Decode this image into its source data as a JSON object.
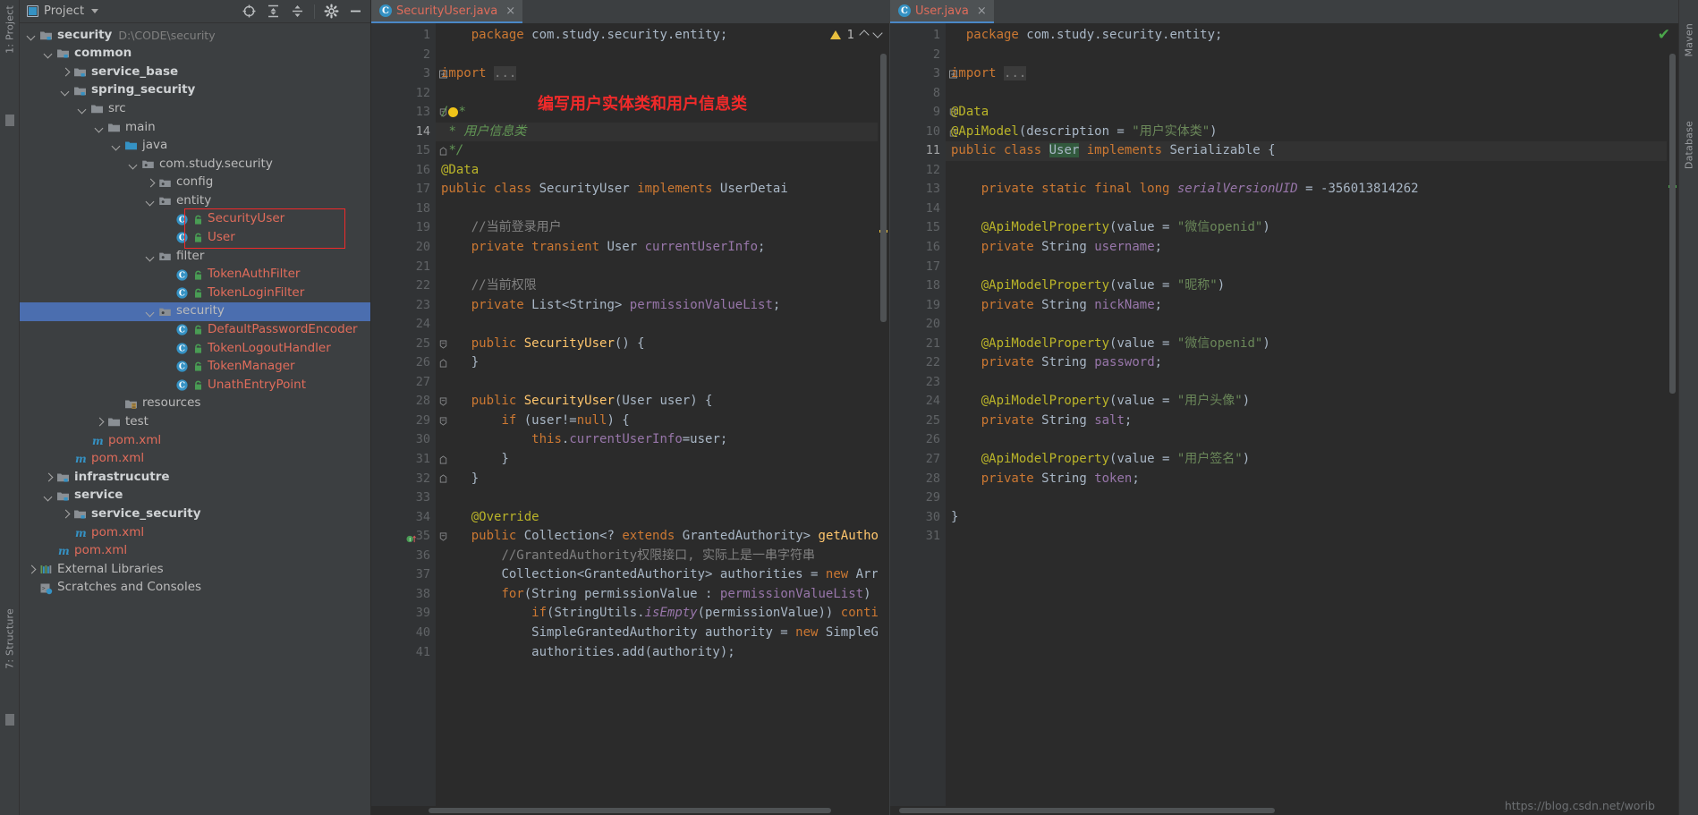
{
  "window": {
    "left_rail_labels": [
      "1: Project",
      "7: Structure"
    ],
    "right_rail_labels": [
      "Maven",
      "Database"
    ],
    "watermark": "https://blog.csdn.net/worib"
  },
  "project_panel": {
    "title": "Project",
    "title_icon": "project-window-icon",
    "actions": [
      {
        "name": "locate-icon",
        "glyph": "target"
      },
      {
        "name": "expand-all-icon",
        "glyph": "expand"
      },
      {
        "name": "collapse-all-icon",
        "glyph": "collapse"
      },
      {
        "name": "settings-gear-icon",
        "glyph": "gear"
      },
      {
        "name": "hide-panel-icon",
        "glyph": "minus"
      }
    ],
    "tree": [
      {
        "depth": 0,
        "arrow": "down",
        "icon": "module-folder",
        "label": "security",
        "style": "bold",
        "sub": "D:\\CODE\\security"
      },
      {
        "depth": 1,
        "arrow": "down",
        "icon": "module-folder",
        "label": "common",
        "style": "bold",
        "sub": ""
      },
      {
        "depth": 2,
        "arrow": "right",
        "icon": "module-folder",
        "label": "service_base",
        "style": "bold",
        "sub": ""
      },
      {
        "depth": 2,
        "arrow": "down",
        "icon": "module-folder",
        "label": "spring_security",
        "style": "bold",
        "sub": ""
      },
      {
        "depth": 3,
        "arrow": "down",
        "icon": "folder",
        "label": "src",
        "style": "plain",
        "sub": ""
      },
      {
        "depth": 4,
        "arrow": "down",
        "icon": "folder",
        "label": "main",
        "style": "plain",
        "sub": ""
      },
      {
        "depth": 5,
        "arrow": "down",
        "icon": "source-folder",
        "label": "java",
        "style": "plain",
        "sub": ""
      },
      {
        "depth": 6,
        "arrow": "down",
        "icon": "package",
        "label": "com.study.security",
        "style": "plain",
        "sub": ""
      },
      {
        "depth": 7,
        "arrow": "right",
        "icon": "package",
        "label": "config",
        "style": "plain",
        "sub": ""
      },
      {
        "depth": 7,
        "arrow": "down",
        "icon": "package",
        "label": "entity",
        "style": "plain",
        "sub": ""
      },
      {
        "depth": 8,
        "arrow": "none",
        "icon": "java-class",
        "label": "SecurityUser",
        "style": "red",
        "sub": ""
      },
      {
        "depth": 8,
        "arrow": "none",
        "icon": "java-class",
        "label": "User",
        "style": "red",
        "sub": ""
      },
      {
        "depth": 7,
        "arrow": "down",
        "icon": "package",
        "label": "filter",
        "style": "plain",
        "sub": ""
      },
      {
        "depth": 8,
        "arrow": "none",
        "icon": "java-class",
        "label": "TokenAuthFilter",
        "style": "red",
        "sub": ""
      },
      {
        "depth": 8,
        "arrow": "none",
        "icon": "java-class",
        "label": "TokenLoginFilter",
        "style": "red",
        "sub": ""
      },
      {
        "depth": 7,
        "arrow": "down",
        "icon": "package",
        "label": "security",
        "style": "plain",
        "sub": "",
        "selected": true
      },
      {
        "depth": 8,
        "arrow": "none",
        "icon": "java-class",
        "label": "DefaultPasswordEncoder",
        "style": "red",
        "sub": ""
      },
      {
        "depth": 8,
        "arrow": "none",
        "icon": "java-class",
        "label": "TokenLogoutHandler",
        "style": "red",
        "sub": ""
      },
      {
        "depth": 8,
        "arrow": "none",
        "icon": "java-class",
        "label": "TokenManager",
        "style": "red",
        "sub": ""
      },
      {
        "depth": 8,
        "arrow": "none",
        "icon": "java-class",
        "label": "UnathEntryPoint",
        "style": "red",
        "sub": ""
      },
      {
        "depth": 5,
        "arrow": "none",
        "icon": "resources-folder",
        "label": "resources",
        "style": "plain",
        "sub": ""
      },
      {
        "depth": 4,
        "arrow": "right",
        "icon": "folder",
        "label": "test",
        "style": "plain",
        "sub": ""
      },
      {
        "depth": 3,
        "arrow": "none",
        "icon": "maven-file",
        "label": "pom.xml",
        "style": "red",
        "sub": ""
      },
      {
        "depth": 2,
        "arrow": "none",
        "icon": "maven-file",
        "label": "pom.xml",
        "style": "red",
        "sub": ""
      },
      {
        "depth": 1,
        "arrow": "right",
        "icon": "module-folder",
        "label": "infrastrucutre",
        "style": "bold",
        "sub": ""
      },
      {
        "depth": 1,
        "arrow": "down",
        "icon": "module-folder",
        "label": "service",
        "style": "bold",
        "sub": ""
      },
      {
        "depth": 2,
        "arrow": "right",
        "icon": "module-folder",
        "label": "service_security",
        "style": "bold",
        "sub": ""
      },
      {
        "depth": 2,
        "arrow": "none",
        "icon": "maven-file",
        "label": "pom.xml",
        "style": "red",
        "sub": ""
      },
      {
        "depth": 1,
        "arrow": "none",
        "icon": "maven-file",
        "label": "pom.xml",
        "style": "red",
        "sub": ""
      },
      {
        "depth": 0,
        "arrow": "right",
        "icon": "libraries",
        "label": "External Libraries",
        "style": "plain",
        "sub": ""
      },
      {
        "depth": 0,
        "arrow": "none",
        "icon": "scratches",
        "label": "Scratches and Consoles",
        "style": "plain",
        "sub": ""
      }
    ]
  },
  "annotation": {
    "text": "编写用户实体类和用户信息类",
    "color": "#f02a2a"
  },
  "editor_left": {
    "tab": {
      "label": "SecurityUser.java",
      "icon": "java-class-icon",
      "close": "×"
    },
    "inspection": {
      "warning_count": "1",
      "warning_icon": "warning-triangle"
    },
    "lines": [
      {
        "n": "1",
        "fold": "",
        "html": "    <span class=\"k\">package</span> com.study.security.entity;"
      },
      {
        "n": "2",
        "fold": "",
        "html": ""
      },
      {
        "n": "3",
        "fold": "plus",
        "html": "<span class=\"k\">import</span> <span class=\"cm\" style=\"background:#3b3b3b\">...</span>"
      },
      {
        "n": "12",
        "fold": "",
        "html": ""
      },
      {
        "n": "13",
        "fold": "minus",
        "html": "<span class=\"jd\">/</span><span class=\"bulbslot\"></span><span class=\"jd\">*</span>"
      },
      {
        "n": "14",
        "fold": "",
        "hl": true,
        "html": " <span class=\"jd\">* 用户信息类</span>"
      },
      {
        "n": "15",
        "fold": "end",
        "html": " <span class=\"jd\">*/</span>"
      },
      {
        "n": "16",
        "fold": "",
        "html": "<span class=\"an\">@Data</span>"
      },
      {
        "n": "17",
        "fold": "",
        "html": "<span class=\"k\">public class</span> <span class=\"nm\">SecurityUser</span> <span class=\"k\">implements</span> <span class=\"nm\">UserDetai</span>"
      },
      {
        "n": "18",
        "fold": "",
        "html": ""
      },
      {
        "n": "19",
        "fold": "",
        "html": "    <span class=\"cm\">//当前登录用户</span>"
      },
      {
        "n": "20",
        "fold": "",
        "html": "    <span class=\"k\">private transient</span> <span class=\"nm\">User</span> <span class=\"fl\">currentUserInfo</span>;"
      },
      {
        "n": "21",
        "fold": "",
        "html": ""
      },
      {
        "n": "22",
        "fold": "",
        "html": "    <span class=\"cm\">//当前权限</span>"
      },
      {
        "n": "23",
        "fold": "",
        "html": "    <span class=\"k\">private</span> <span class=\"nm\">List&lt;String&gt;</span> <span class=\"fl\">permissionValueList</span>;"
      },
      {
        "n": "24",
        "fold": "",
        "html": ""
      },
      {
        "n": "25",
        "fold": "minus",
        "html": "    <span class=\"k\">public</span> <span class=\"cn\">SecurityUser</span>() {"
      },
      {
        "n": "26",
        "fold": "end",
        "html": "    }"
      },
      {
        "n": "27",
        "fold": "",
        "html": ""
      },
      {
        "n": "28",
        "fold": "minus",
        "html": "    <span class=\"k\">public</span> <span class=\"cn\">SecurityUser</span>(<span class=\"nm\">User</span> user) {"
      },
      {
        "n": "29",
        "fold": "minus",
        "html": "        <span class=\"k\">if</span> (user!=<span class=\"k\">null</span>) {"
      },
      {
        "n": "30",
        "fold": "",
        "html": "            <span class=\"k\">this</span>.<span class=\"fl\">currentUserInfo</span>=user;"
      },
      {
        "n": "31",
        "fold": "end",
        "html": "        }"
      },
      {
        "n": "32",
        "fold": "end",
        "html": "    }"
      },
      {
        "n": "33",
        "fold": "",
        "html": ""
      },
      {
        "n": "34",
        "fold": "",
        "html": "    <span class=\"an\">@Override</span>"
      },
      {
        "n": "35",
        "fold": "minus",
        "gicon": "implements-marker",
        "html": "    <span class=\"k\">public</span> <span class=\"nm\">Collection&lt;?</span> <span class=\"k\">extends</span> <span class=\"nm\">GrantedAuthority&gt;</span> <span class=\"cn\">getAuthoriti</span>"
      },
      {
        "n": "36",
        "fold": "",
        "html": "        <span class=\"cm\">//GrantedAuthority权限接口, 实际上是一串字符串</span>"
      },
      {
        "n": "37",
        "fold": "",
        "html": "        <span class=\"nm\">Collection&lt;GrantedAuthority&gt;</span> authorities = <span class=\"k\">new</span> <span class=\"nm\">ArrayLi</span>"
      },
      {
        "n": "38",
        "fold": "",
        "html": "        <span class=\"k\">for</span>(<span class=\"nm\">String</span> permissionValue : <span class=\"fl\">permissionValueList</span>) {"
      },
      {
        "n": "39",
        "fold": "",
        "html": "            <span class=\"k\">if</span>(<span class=\"nm\">StringUtils</span>.<span class=\"stc\">isEmpty</span>(permissionValue)) <span class=\"k\">continue</span>;"
      },
      {
        "n": "40",
        "fold": "",
        "html": "            <span class=\"nm\">SimpleGrantedAuthority</span> authority = <span class=\"k\">new</span> <span class=\"nm\">SimpleGrant</span>"
      },
      {
        "n": "41",
        "fold": "",
        "html": "            authorities.add(authority);"
      }
    ]
  },
  "editor_right": {
    "tab": {
      "label": "User.java",
      "icon": "java-class-icon",
      "close": "×"
    },
    "inspection": {
      "status": "ok",
      "status_icon": "green-check"
    },
    "lines": [
      {
        "n": "1",
        "fold": "",
        "html": "  <span class=\"k\">package</span> com.study.security.entity;"
      },
      {
        "n": "2",
        "fold": "",
        "html": ""
      },
      {
        "n": "3",
        "fold": "plus",
        "html": "<span class=\"k\">import</span> <span class=\"cm\" style=\"background:#3b3b3b\">...</span>"
      },
      {
        "n": "8",
        "fold": "",
        "html": ""
      },
      {
        "n": "9",
        "fold": "minus",
        "html": "<span class=\"an\">@Data</span>"
      },
      {
        "n": "10",
        "fold": "end",
        "html": "<span class=\"an\">@ApiModel</span>(description = <span class=\"s\">\"用户实体类\"</span>)"
      },
      {
        "n": "11",
        "fold": "",
        "hl": true,
        "html": "<span class=\"k\">public class</span> <span class=\"hlw\">User</span> <span class=\"k\">implements</span> <span class=\"nm\">Serializable</span> {"
      },
      {
        "n": "12",
        "fold": "",
        "html": ""
      },
      {
        "n": "13",
        "fold": "",
        "html": "    <span class=\"k\">private static final long</span> <span class=\"stc\">serialVersionUID</span> = -356013814262"
      },
      {
        "n": "14",
        "fold": "",
        "html": ""
      },
      {
        "n": "15",
        "fold": "",
        "html": "    <span class=\"an\">@ApiModelProperty</span>(value = <span class=\"s\">\"微信openid\"</span>)"
      },
      {
        "n": "16",
        "fold": "",
        "html": "    <span class=\"k\">private</span> <span class=\"nm\">String</span> <span class=\"fl\">username</span>;"
      },
      {
        "n": "17",
        "fold": "",
        "html": ""
      },
      {
        "n": "18",
        "fold": "",
        "html": "    <span class=\"an\">@ApiModelProperty</span>(value = <span class=\"s\">\"昵称\"</span>)"
      },
      {
        "n": "19",
        "fold": "",
        "html": "    <span class=\"k\">private</span> <span class=\"nm\">String</span> <span class=\"fl\">nickName</span>;"
      },
      {
        "n": "20",
        "fold": "",
        "html": ""
      },
      {
        "n": "21",
        "fold": "",
        "html": "    <span class=\"an\">@ApiModelProperty</span>(value = <span class=\"s\">\"微信openid\"</span>)"
      },
      {
        "n": "22",
        "fold": "",
        "html": "    <span class=\"k\">private</span> <span class=\"nm\">String</span> <span class=\"fl\">password</span>;"
      },
      {
        "n": "23",
        "fold": "",
        "html": ""
      },
      {
        "n": "24",
        "fold": "",
        "html": "    <span class=\"an\">@ApiModelProperty</span>(value = <span class=\"s\">\"用户头像\"</span>)"
      },
      {
        "n": "25",
        "fold": "",
        "html": "    <span class=\"k\">private</span> <span class=\"nm\">String</span> <span class=\"fl\">salt</span>;"
      },
      {
        "n": "26",
        "fold": "",
        "html": ""
      },
      {
        "n": "27",
        "fold": "",
        "html": "    <span class=\"an\">@ApiModelProperty</span>(value = <span class=\"s\">\"用户签名\"</span>)"
      },
      {
        "n": "28",
        "fold": "",
        "html": "    <span class=\"k\">private</span> <span class=\"nm\">String</span> <span class=\"fl\">token</span>;"
      },
      {
        "n": "29",
        "fold": "",
        "html": ""
      },
      {
        "n": "30",
        "fold": "",
        "html": "}"
      },
      {
        "n": "31",
        "fold": "",
        "html": ""
      }
    ]
  }
}
